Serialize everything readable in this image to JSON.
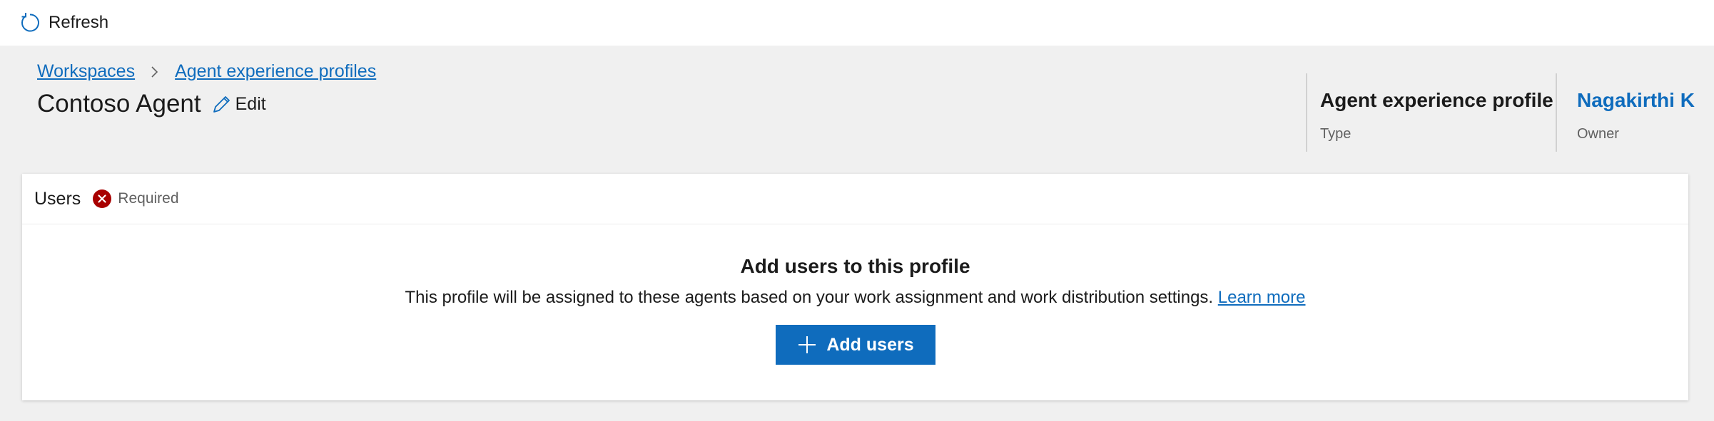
{
  "toolbar": {
    "refresh_label": "Refresh",
    "refresh_icon": "refresh-icon"
  },
  "breadcrumb": {
    "items": [
      "Workspaces",
      "Agent experience profiles"
    ],
    "separator_icon": "chevron-right-icon"
  },
  "header": {
    "title": "Contoso Agent",
    "edit_label": "Edit",
    "edit_icon": "pencil-icon"
  },
  "meta": {
    "type_value": "Agent experience profile",
    "type_label": "Type",
    "owner_value": "Nagakirthi K",
    "owner_label": "Owner"
  },
  "users_card": {
    "title": "Users",
    "status_icon": "error-circle-icon",
    "status_label": "Required",
    "empty_title": "Add users to this profile",
    "empty_description": "This profile will be assigned to these agents based on your work assignment and work distribution settings.",
    "learn_more_label": "Learn more",
    "add_button_label": "Add users",
    "add_icon": "plus-icon"
  },
  "colors": {
    "accent": "#0f6cbd",
    "error": "#a80000",
    "background": "#f0f0f0",
    "surface": "#ffffff"
  }
}
